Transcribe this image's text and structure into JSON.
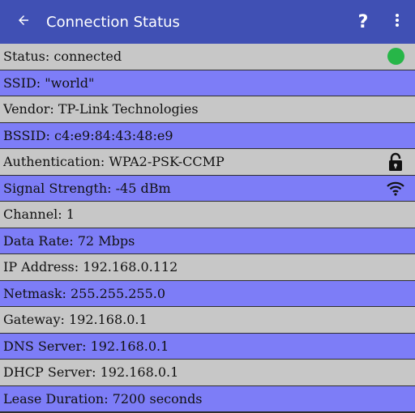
{
  "header": {
    "title": "Connection Status",
    "help_label": "?",
    "back_icon": "arrow-back-icon",
    "menu_icon": "more-vert-icon",
    "color": "#4050b4"
  },
  "rows": [
    {
      "label": "Status: connected",
      "icon": "status-dot-icon",
      "color": "#c7c7c7"
    },
    {
      "label": "SSID: \"world\"",
      "color": "#7d7df7"
    },
    {
      "label": "Vendor: TP-Link Technologies",
      "color": "#c7c7c7"
    },
    {
      "label": "BSSID: c4:e9:84:43:48:e9",
      "color": "#7d7df7"
    },
    {
      "label": "Authentication: WPA2-PSK-CCMP",
      "icon": "lock-icon",
      "color": "#c7c7c7"
    },
    {
      "label": "Signal Strength: -45 dBm",
      "icon": "wifi-icon",
      "color": "#7d7df7"
    },
    {
      "label": "Channel: 1",
      "color": "#c7c7c7"
    },
    {
      "label": "Data Rate: 72 Mbps",
      "color": "#7d7df7"
    },
    {
      "label": "IP Address: 192.168.0.112",
      "color": "#c7c7c7"
    },
    {
      "label": "Netmask: 255.255.255.0",
      "color": "#7d7df7"
    },
    {
      "label": "Gateway: 192.168.0.1",
      "color": "#c7c7c7"
    },
    {
      "label": "DNS Server: 192.168.0.1",
      "color": "#7d7df7"
    },
    {
      "label": "DHCP Server: 192.168.0.1",
      "color": "#c7c7c7"
    },
    {
      "label": "Lease Duration: 7200 seconds",
      "color": "#7d7df7"
    }
  ],
  "status_color": "#27b648"
}
